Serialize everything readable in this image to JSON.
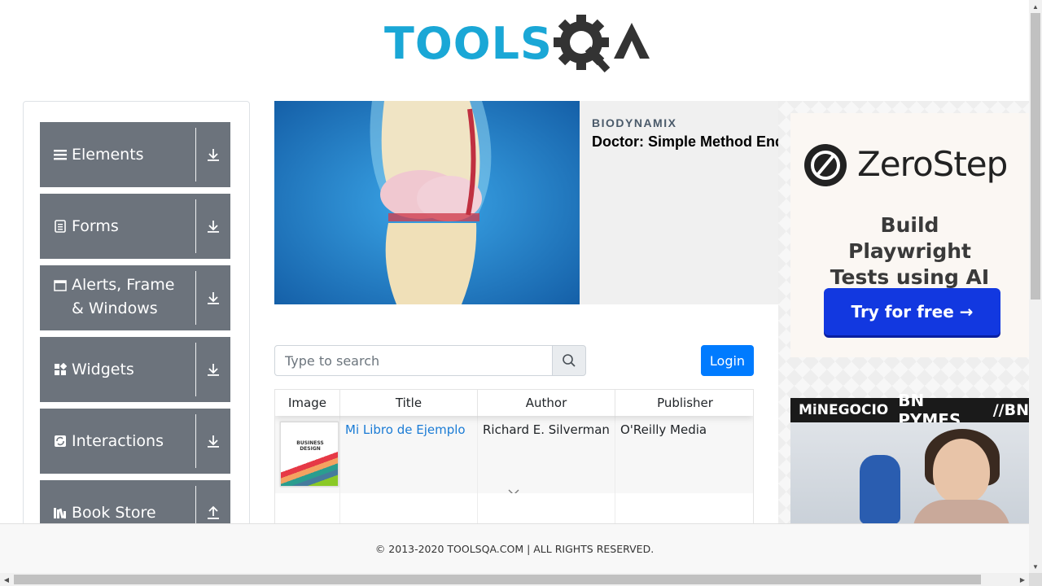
{
  "header": {
    "logo_text": "TOOLS",
    "logo_suffix": "QA"
  },
  "sidebar": {
    "groups": [
      {
        "label": "Elements",
        "icon": "hamburger-icon",
        "arrow": "download-icon"
      },
      {
        "label": "Forms",
        "icon": "document-icon",
        "arrow": "download-icon"
      },
      {
        "label": "Alerts, Frame & Windows",
        "icon": "window-icon",
        "arrow": "download-icon"
      },
      {
        "label": "Widgets",
        "icon": "widgets-icon",
        "arrow": "download-icon"
      },
      {
        "label": "Interactions",
        "icon": "interactions-icon",
        "arrow": "download-icon"
      },
      {
        "label": "Book Store",
        "icon": "books-icon",
        "arrow": "upload-icon"
      }
    ]
  },
  "ad_top": {
    "brand": "BIODYNAMIX",
    "headline": "Doctor: Simple Method End"
  },
  "ad_right": {
    "zerostep": {
      "name": "ZeroStep",
      "tagline": "Build Playwright Tests using AI",
      "cta": "Try for free →"
    },
    "bn": {
      "brand1": "MiNEGOCIO",
      "brand2": "BN PYMES",
      "brand3": "//BN"
    }
  },
  "search": {
    "placeholder": "Type to search"
  },
  "login": {
    "label": "Login"
  },
  "table": {
    "headers": [
      "Image",
      "Title",
      "Author",
      "Publisher"
    ],
    "rows": [
      {
        "cover_title": "BUSINESS DESIGN",
        "title": "Mi Libro de Ejemplo",
        "author": "Richard E. Silverman",
        "publisher": "O'Reilly Media"
      }
    ]
  },
  "footer": {
    "text": "© 2013-2020 TOOLSQA.COM | ALL RIGHTS RESERVED."
  },
  "colors": {
    "sidebar_group": "#6c737c",
    "primary": "#007bff",
    "logo_blue": "#1aa7d6",
    "link": "#1a7bd5"
  }
}
